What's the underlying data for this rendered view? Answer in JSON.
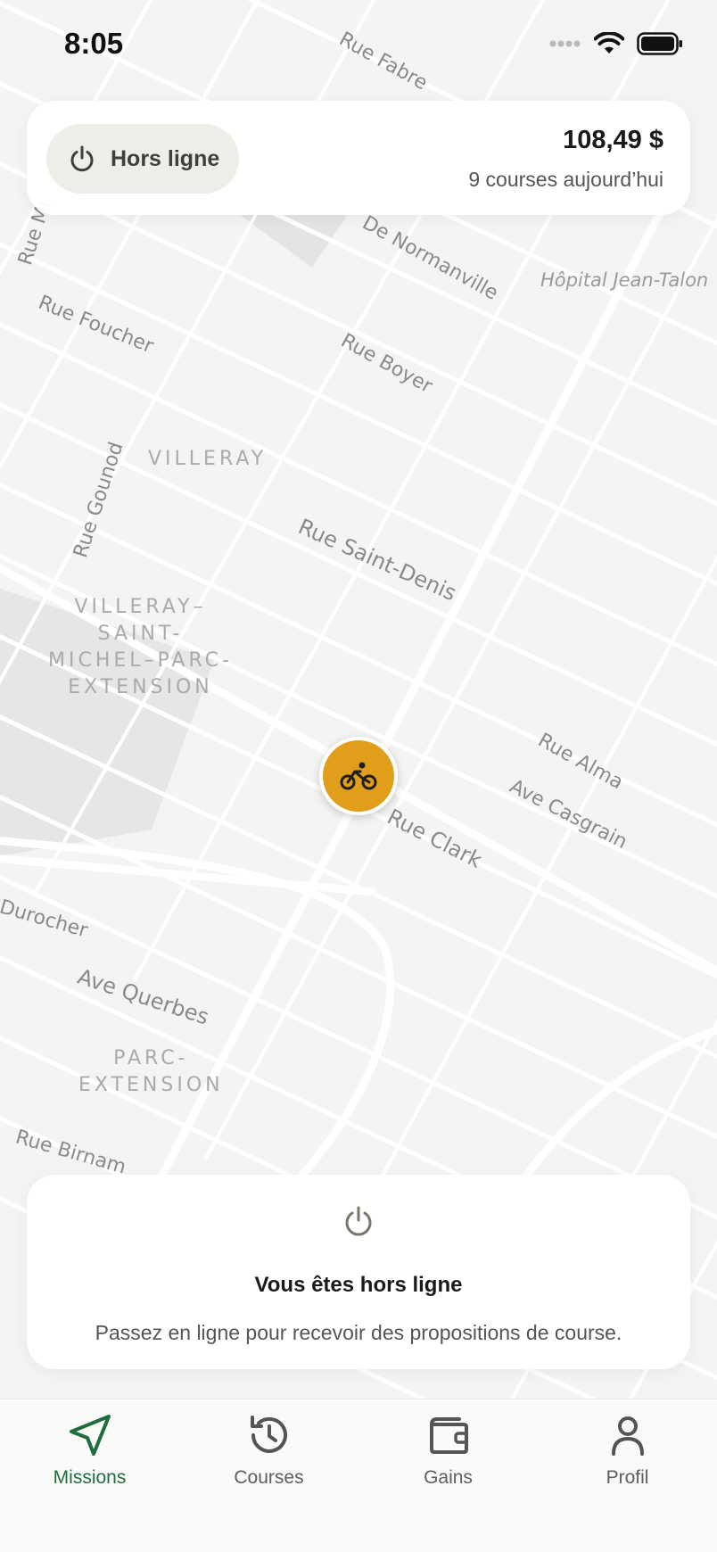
{
  "status_bar": {
    "time": "8:05"
  },
  "top_card": {
    "status_label": "Hors ligne",
    "earnings_amount": "108,49 $",
    "rides_today": "9 courses aujourd’hui"
  },
  "map": {
    "streets": [
      "Rue Fabre",
      "De Normanville",
      "Rue Mi",
      "Rue Foucher",
      "Rue Boyer",
      "Rue Gounod",
      "Rue Saint-Denis",
      "Rue Alma",
      "Ave Casgrain",
      "Rue Clark",
      "Durocher",
      "Ave Querbes",
      "Rue Birnam"
    ],
    "neighbourhoods": [
      "VILLERAY",
      "VILLERAY–\nSAINT-\nMICHEL–PARC-\nEXTENSION",
      "PARC-\nEXTENSION"
    ],
    "poi": "Hôpital Jean-Talon",
    "colors": {
      "background": "#f4f4f3",
      "road": "#ffffff",
      "park": "#e6e7e5"
    }
  },
  "marker": {
    "icon": "bicycle-icon",
    "color": "#e09e1b"
  },
  "offline_card": {
    "icon": "power-icon",
    "title": "Vous êtes hors ligne",
    "message": "Passez en ligne pour recevoir des propositions de course."
  },
  "tabs": [
    {
      "label": "Missions",
      "icon": "navigation-arrow-icon",
      "active": true
    },
    {
      "label": "Courses",
      "icon": "history-icon",
      "active": false
    },
    {
      "label": "Gains",
      "icon": "wallet-icon",
      "active": false
    },
    {
      "label": "Profil",
      "icon": "user-icon",
      "active": false
    }
  ],
  "colors": {
    "accent": "#1f6d3f",
    "marker": "#e09e1b",
    "pill": "#efede8"
  }
}
